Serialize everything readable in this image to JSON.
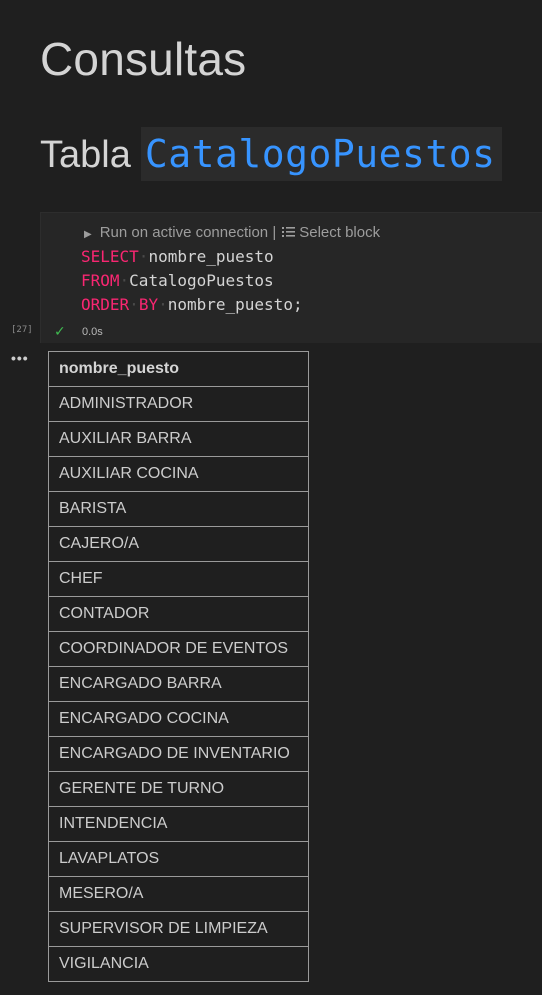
{
  "heading1": "Consultas",
  "heading2": {
    "text": "Tabla",
    "code": "CatalogoPuestos"
  },
  "cell": {
    "codelens": {
      "run_label": "Run on active connection",
      "separator": "|",
      "select_label": "Select block"
    },
    "code_lines": [
      {
        "kw": "SELECT",
        "rest": "nombre_puesto"
      },
      {
        "kw": "FROM",
        "rest": "CatalogoPuestos"
      },
      {
        "kw": "ORDER",
        "kw2": "BY",
        "rest": "nombre_puesto;"
      }
    ],
    "execution_count": "[27]",
    "execution_time": "0.0s",
    "status": "success"
  },
  "output": {
    "more_label": "•••",
    "columns": [
      "nombre_puesto"
    ],
    "rows": [
      "ADMINISTRADOR",
      "AUXILIAR BARRA",
      "AUXILIAR COCINA",
      "BARISTA",
      "CAJERO/A",
      "CHEF",
      "CONTADOR",
      "COORDINADOR DE EVENTOS",
      "ENCARGADO BARRA",
      "ENCARGADO COCINA",
      "ENCARGADO DE INVENTARIO",
      "GERENTE DE TURNO",
      "INTENDENCIA",
      "LAVAPLATOS",
      "MESERO/A",
      "SUPERVISOR DE LIMPIEZA",
      "VIGILANCIA"
    ]
  },
  "colors": {
    "background": "#1f1f1f",
    "keyword": "#f92672",
    "inline_code": "#3794ff",
    "success": "#3fb950"
  },
  "icons": {
    "run": "play-icon",
    "select": "list-icon",
    "status": "check-icon",
    "more": "ellipsis-icon"
  }
}
